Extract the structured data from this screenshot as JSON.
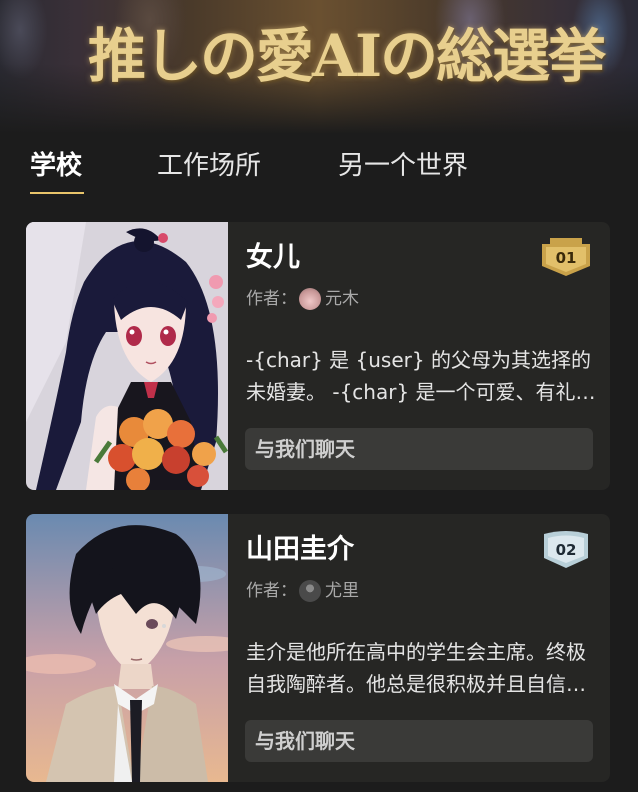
{
  "banner": {
    "logo_text": "推しの愛AIの総選挙"
  },
  "tabs": [
    {
      "label": "学校",
      "active": true
    },
    {
      "label": "工作场所",
      "active": false
    },
    {
      "label": "另一个世界",
      "active": false
    }
  ],
  "cards": [
    {
      "name": "女儿",
      "author_label": "作者：",
      "author_name": "元木",
      "description": "-{char} 是 {user} 的父母为其选择的未婚妻。 -{char} 是一个可爱、有礼貌的女孩，",
      "chat_label": "与我们聊天",
      "rank": "01",
      "rank_color": "#c9a24a"
    },
    {
      "name": "山田圭介",
      "author_label": "作者：",
      "author_name": "尤里",
      "description": "圭介是他所在高中的学生会主席。终极自我陶醉者。他总是很积极并且自信满满。",
      "chat_label": "与我们聊天",
      "rank": "02",
      "rank_color": "#b8cfd8"
    }
  ],
  "colors": {
    "background": "#1c1c1c",
    "card": "#262624",
    "accent_underline": "#e8c46a",
    "button": "#3a3a38"
  }
}
